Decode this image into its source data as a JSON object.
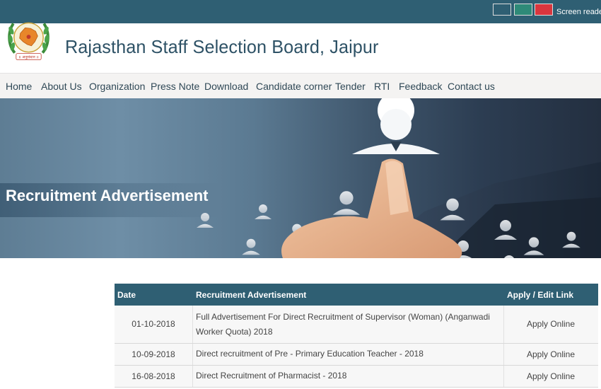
{
  "topbar": {
    "theme_colors": [
      "#2f5f73",
      "#2e8a78",
      "#d9363e"
    ],
    "screen_reader_label": "Screen reader a"
  },
  "header": {
    "logo_text": "॥ अनुसंधान ॥",
    "title": "Rajasthan Staff Selection Board, Jaipur"
  },
  "nav": {
    "items": [
      "Home",
      "About Us",
      "Organization",
      "Press Note",
      "Download",
      "Candidate corner",
      "Tender",
      "RTI",
      "Feedback",
      "Contact us"
    ]
  },
  "banner": {
    "title": "Recruitment Advertisement"
  },
  "table": {
    "headers": [
      "Date",
      "Recruitment Advertisement",
      "Apply / Edit Link"
    ],
    "rows": [
      {
        "date": "01-10-2018",
        "title": "Full Advertisement For Direct Recruitment of Supervisor (Woman) (Anganwadi Worker Quota) 2018",
        "link": "Apply Online"
      },
      {
        "date": "10-09-2018",
        "title": "Direct recruitment of Pre - Primary Education Teacher - 2018",
        "link": "Apply Online"
      },
      {
        "date": "16-08-2018",
        "title": "Direct Recruitment of Pharmacist - 2018",
        "link": "Apply Online"
      }
    ]
  },
  "colors": {
    "primary": "#2f5f73",
    "title_text": "#2e5266"
  }
}
